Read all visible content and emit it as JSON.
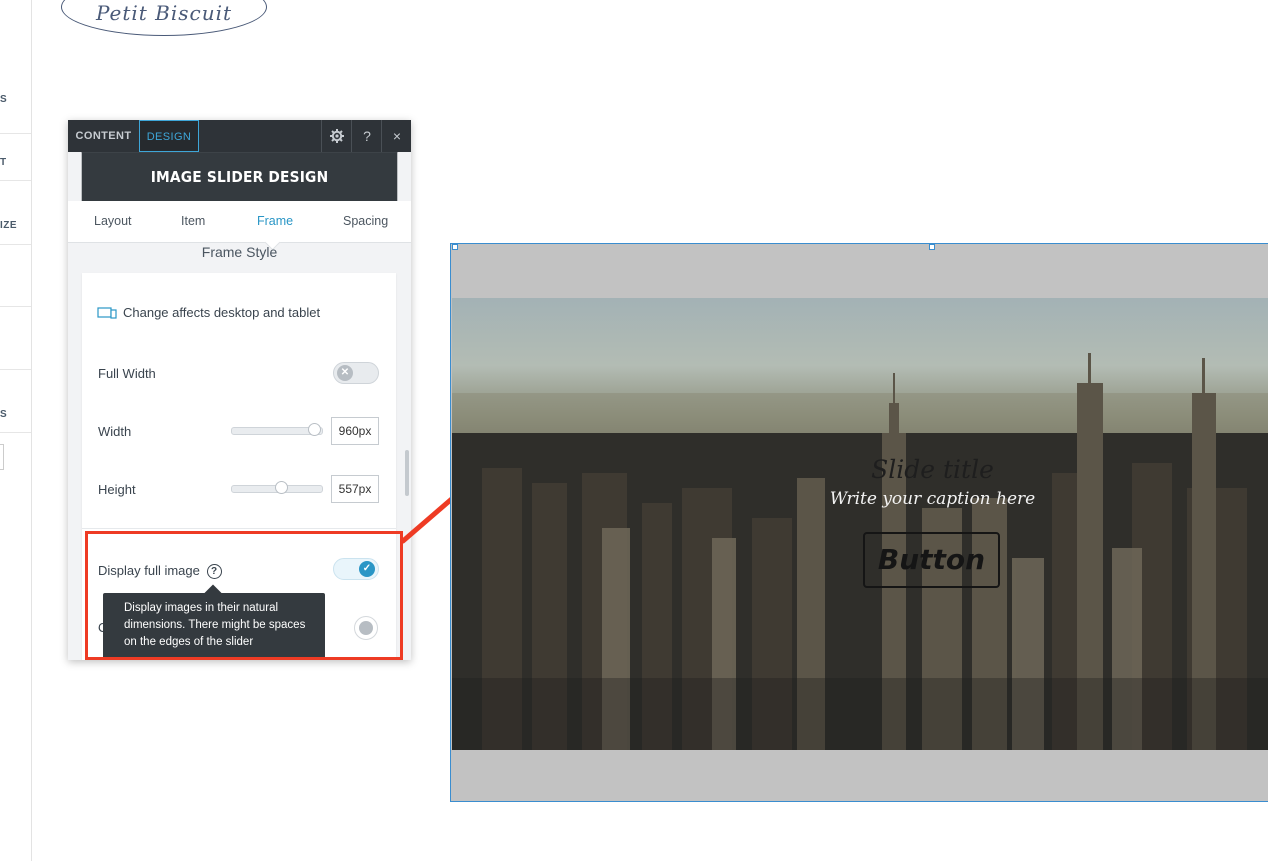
{
  "editor_rail": {
    "items": [
      "S",
      "T",
      "IZE",
      "S"
    ]
  },
  "logo": {
    "text": "Petit Biscuit"
  },
  "panel": {
    "top_tabs": {
      "content": "CONTENT",
      "design": "DESIGN"
    },
    "icons": {
      "settings": "gear-icon",
      "help": "?",
      "close": "×"
    },
    "title": "IMAGE SLIDER DESIGN",
    "sub_tabs": [
      "Layout",
      "Item",
      "Frame",
      "Spacing"
    ],
    "active_sub_tab": "Frame",
    "section_title": "Frame Style",
    "device_notice": "Change affects desktop and tablet",
    "full_width": {
      "label": "Full Width",
      "on": false
    },
    "width": {
      "label": "Width",
      "value": "960px",
      "level": 0.98
    },
    "height": {
      "label": "Height",
      "value": "557px",
      "level": 0.55
    },
    "display_full_image": {
      "label": "Display full image",
      "help": "?",
      "on": true
    },
    "tooltip": "Display images in their natural dimensions. There might be spaces on the edges of the slider",
    "clipped_row_label": "Ove"
  },
  "preview": {
    "slide_title": "Slide title",
    "caption": "Write your caption here",
    "button_label": "Button"
  },
  "colors": {
    "accent": "#2a96c6",
    "annotation": "#ee3b24",
    "panel_dark": "#2e3338"
  }
}
